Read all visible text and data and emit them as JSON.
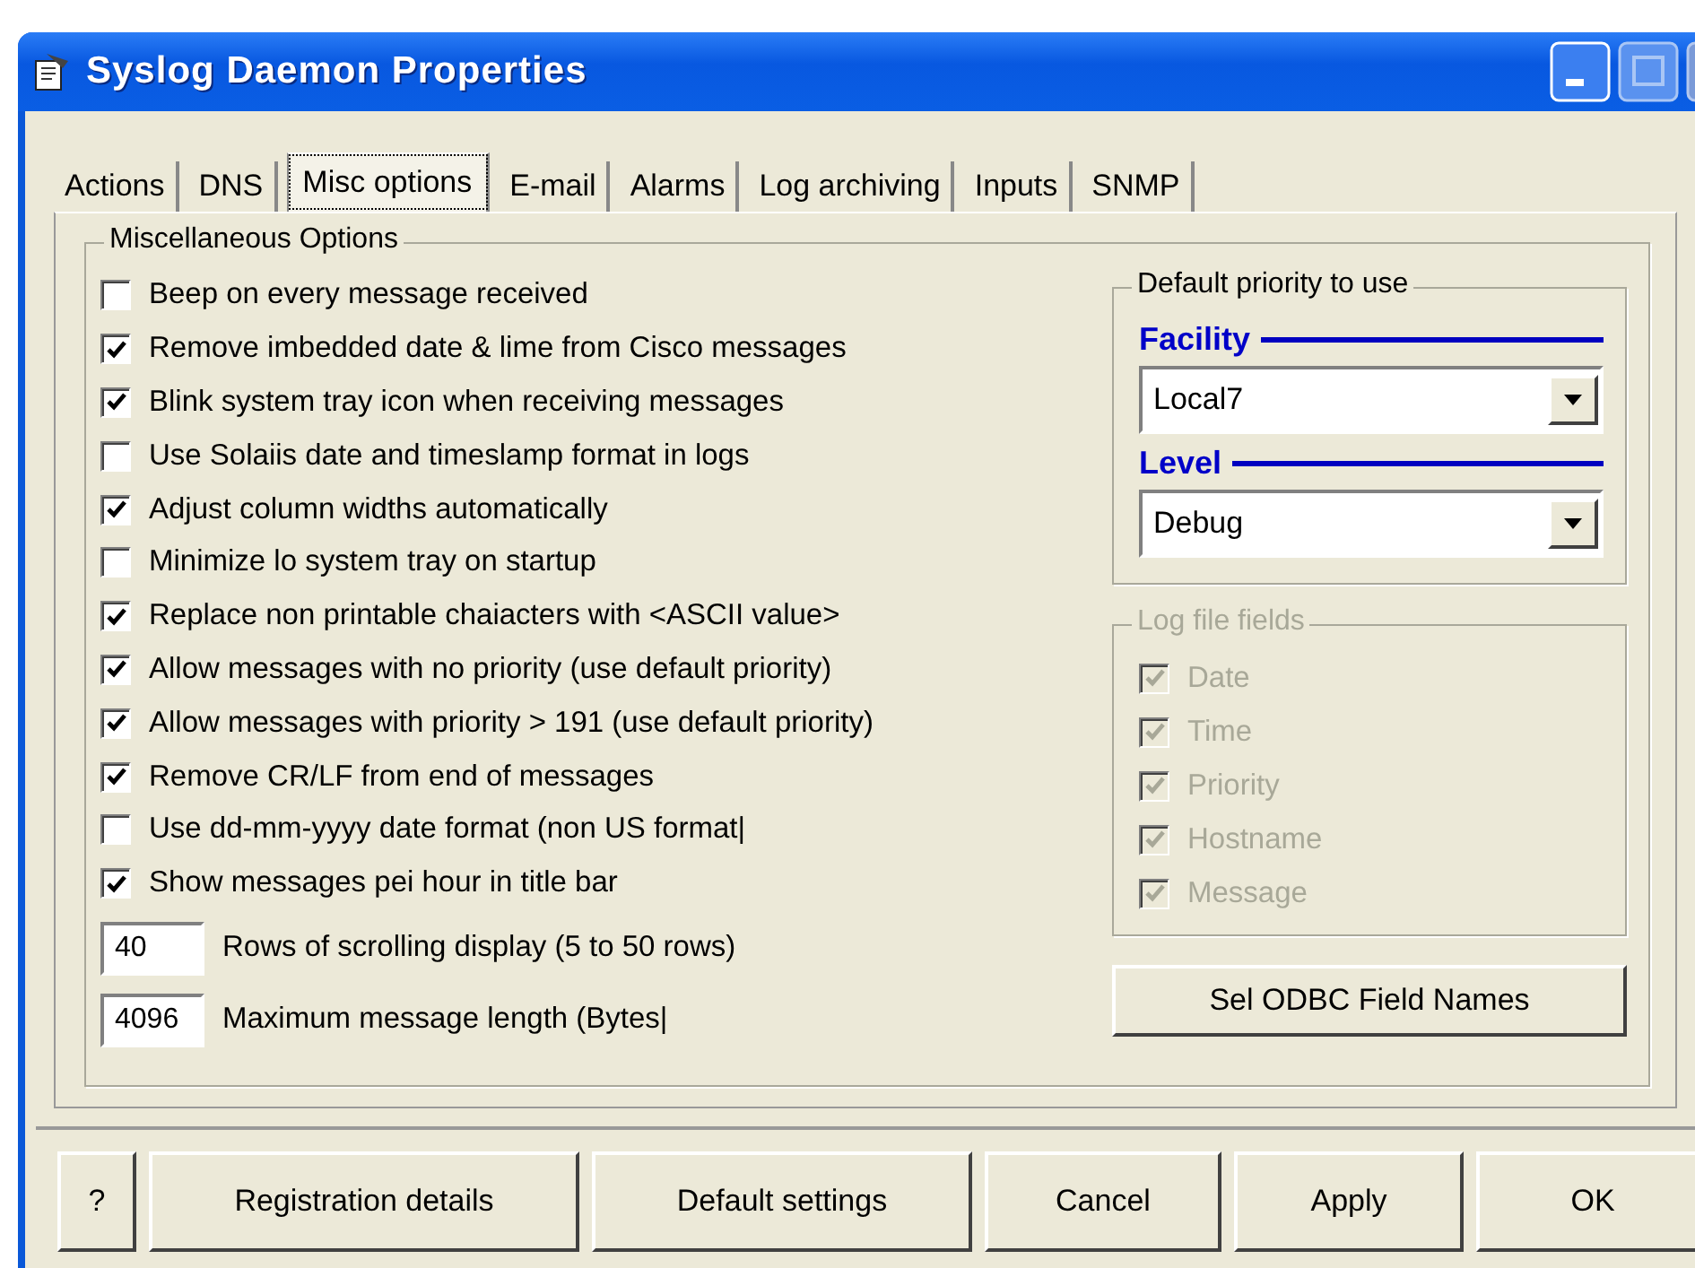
{
  "window": {
    "title": "Syslog Daemon Properties"
  },
  "tabs": [
    {
      "label": "Actions",
      "selected": false
    },
    {
      "label": "DNS",
      "selected": false
    },
    {
      "label": "Misc options",
      "selected": true
    },
    {
      "label": "E-mail",
      "selected": false
    },
    {
      "label": "Alarms",
      "selected": false
    },
    {
      "label": "Log archiving",
      "selected": false
    },
    {
      "label": "Inputs",
      "selected": false
    },
    {
      "label": "SNMP",
      "selected": false
    }
  ],
  "misc_group": {
    "title": "Miscellaneous Options",
    "options": [
      {
        "label": "Beep on every message received",
        "checked": false
      },
      {
        "label": "Remove imbedded date & lime from Cisco messages",
        "checked": true
      },
      {
        "label": "Blink system tray icon when receiving messages",
        "checked": true
      },
      {
        "label": "Use Solaiis date and timeslamp format in logs",
        "checked": false
      },
      {
        "label": "Adjust column widths automatically",
        "checked": true
      },
      {
        "label": "Minimize lo system tray on startup",
        "checked": false
      },
      {
        "label": "Replace non printable chaiacters with <ASCII value>",
        "checked": true
      },
      {
        "label": "Allow messages with no priority (use default priority)",
        "checked": true
      },
      {
        "label": "Allow messages with priority > 191 (use default priority)",
        "checked": true
      },
      {
        "label": "Remove CR/LF from end of messages",
        "checked": true
      },
      {
        "label": "Use dd-mm-yyyy date format (non US format|",
        "checked": false
      },
      {
        "label": "Show messages pei hour in title bar",
        "checked": true
      }
    ],
    "number_fields": [
      {
        "value": "40",
        "label": "Rows of scrolling display (5 to 50 rows)"
      },
      {
        "value": "4096",
        "label": "Maximum message length (Bytes|"
      }
    ]
  },
  "priority_group": {
    "title": "Default priority to use",
    "facility": {
      "label": "Facility",
      "value": "Local7"
    },
    "level": {
      "label": "Level",
      "value": "Debug"
    }
  },
  "log_fields_group": {
    "title": "Log file fields",
    "disabled": true,
    "fields": [
      {
        "label": "Date",
        "checked": true
      },
      {
        "label": "Time",
        "checked": true
      },
      {
        "label": "Priority",
        "checked": true
      },
      {
        "label": "Hostname",
        "checked": true
      },
      {
        "label": "Message",
        "checked": true
      }
    ]
  },
  "odbc_button": "Sel ODBC Field Names",
  "buttons": [
    "?",
    "Registration details",
    "Default settings",
    "Cancel",
    "Apply",
    "OK"
  ]
}
